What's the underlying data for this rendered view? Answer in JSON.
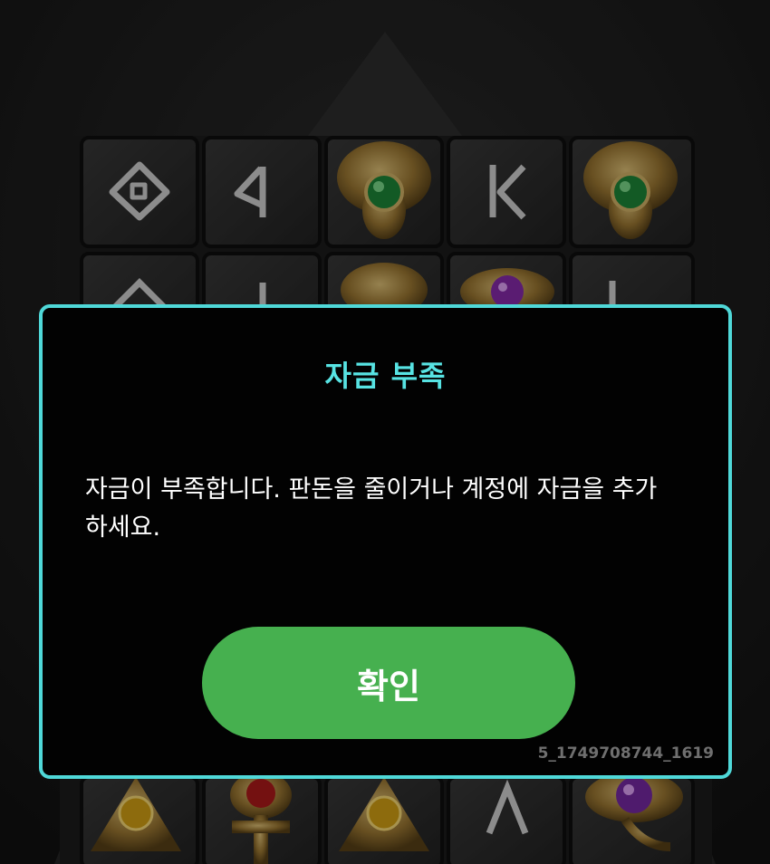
{
  "dialog": {
    "title": "자금 부족",
    "message": "자금이 부족합니다. 판돈을 줄이거나 계정에 자금을 추가하세요.",
    "confirm_label": "확인",
    "session_id": "5_1749708744_1619"
  },
  "colors": {
    "accent": "#4fd8d8",
    "title": "#57e3e3",
    "button": "#46b04f",
    "dialog_bg": "#020202"
  },
  "game_board": {
    "visible_symbols": [
      [
        "rune-diamond-icon",
        "rune-triangle-icon",
        "cobra-emerald-icon",
        "rune-k-icon",
        "cobra-emerald-icon"
      ],
      [
        "rune-diamond-icon",
        "rune-triangle-icon",
        "cobra-emerald-icon",
        "eye-of-horus-amethyst-icon",
        "rune-k-icon"
      ],
      [
        "pyramid-topaz-icon",
        "ankh-ruby-icon",
        "pyramid-topaz-icon",
        "rune-a-icon",
        "eye-of-horus-amethyst-icon"
      ]
    ]
  }
}
